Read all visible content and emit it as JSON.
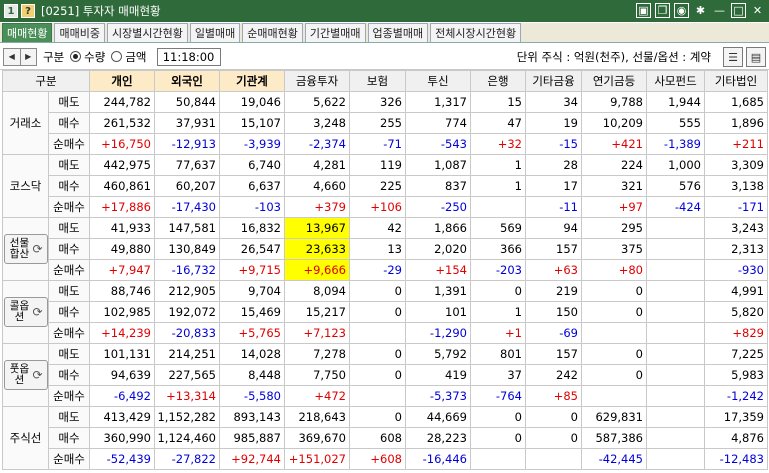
{
  "window": {
    "title": "[0251] 투자자 매매현황",
    "icon_left_1": "1",
    "icon_left_2": "?"
  },
  "tabs": [
    {
      "label": "매매현황",
      "active": true
    },
    {
      "label": "매매비중",
      "active": false
    },
    {
      "label": "시장별시간현황",
      "active": false
    },
    {
      "label": "일별매매",
      "active": false
    },
    {
      "label": "순매매현황",
      "active": false
    },
    {
      "label": "기간별매매",
      "active": false
    },
    {
      "label": "업종별매매",
      "active": false
    },
    {
      "label": "전체시장시간현황",
      "active": false
    }
  ],
  "controls": {
    "type_label": "구분",
    "qty_label": "수량",
    "amount_label": "금액",
    "selected": "수량",
    "time": "11:18:00",
    "unit_text": "단위 주식 : 억원(천주), 선물/옵션 : 계약"
  },
  "table": {
    "headers": [
      "구분",
      "개인",
      "외국인",
      "기관계",
      "금융투자",
      "보험",
      "투신",
      "은행",
      "기타금융",
      "연기금등",
      "사모펀드",
      "기타법인"
    ],
    "groups": [
      {
        "name": "거래소",
        "rows": [
          {
            "label": "매도",
            "values": [
              "244,782",
              "50,844",
              "19,046",
              "5,622",
              "326",
              "1,317",
              "15",
              "34",
              "9,788",
              "1,944",
              "1,685"
            ]
          },
          {
            "label": "매수",
            "values": [
              "261,532",
              "37,931",
              "15,107",
              "3,248",
              "255",
              "774",
              "47",
              "19",
              "10,209",
              "555",
              "1,896"
            ]
          },
          {
            "label": "순매수",
            "values": [
              "+16,750",
              "-12,913",
              "-3,939",
              "-2,374",
              "-71",
              "-543",
              "+32",
              "-15",
              "+421",
              "-1,389",
              "+211"
            ]
          }
        ]
      },
      {
        "name": "코스닥",
        "rows": [
          {
            "label": "매도",
            "values": [
              "442,975",
              "77,637",
              "6,740",
              "4,281",
              "119",
              "1,087",
              "1",
              "28",
              "224",
              "1,000",
              "3,309"
            ]
          },
          {
            "label": "매수",
            "values": [
              "460,861",
              "60,207",
              "6,637",
              "4,660",
              "225",
              "837",
              "1",
              "17",
              "321",
              "576",
              "3,138"
            ]
          },
          {
            "label": "순매수",
            "values": [
              "+17,886",
              "-17,430",
              "-103",
              "+379",
              "+106",
              "-250",
              "",
              "-11",
              "+97",
              "-424",
              "-171"
            ]
          }
        ]
      },
      {
        "name": "선물합산",
        "rows": [
          {
            "label": "매도",
            "values": [
              "41,933",
              "147,581",
              "16,832",
              "13,967",
              "42",
              "1,866",
              "569",
              "94",
              "295",
              "",
              "3,243"
            ]
          },
          {
            "label": "매수",
            "values": [
              "49,880",
              "130,849",
              "26,547",
              "23,633",
              "13",
              "2,020",
              "366",
              "157",
              "375",
              "",
              "2,313"
            ]
          },
          {
            "label": "순매수",
            "values": [
              "+7,947",
              "-16,732",
              "+9,715",
              "+9,666",
              "-29",
              "+154",
              "-203",
              "+63",
              "+80",
              "",
              "-930"
            ]
          }
        ]
      },
      {
        "name": "콜옵션",
        "rows": [
          {
            "label": "매도",
            "values": [
              "88,746",
              "212,905",
              "9,704",
              "8,094",
              "0",
              "1,391",
              "0",
              "219",
              "0",
              "",
              "4,991"
            ]
          },
          {
            "label": "매수",
            "values": [
              "102,985",
              "192,072",
              "15,469",
              "15,217",
              "0",
              "101",
              "1",
              "150",
              "0",
              "",
              "5,820"
            ]
          },
          {
            "label": "순매수",
            "values": [
              "+14,239",
              "-20,833",
              "+5,765",
              "+7,123",
              "",
              "-1,290",
              "+1",
              "-69",
              "",
              "",
              "+829"
            ]
          }
        ]
      },
      {
        "name": "풋옵션",
        "rows": [
          {
            "label": "매도",
            "values": [
              "101,131",
              "214,251",
              "14,028",
              "7,278",
              "0",
              "5,792",
              "801",
              "157",
              "0",
              "",
              "7,225"
            ]
          },
          {
            "label": "매수",
            "values": [
              "94,639",
              "227,565",
              "8,448",
              "7,750",
              "0",
              "419",
              "37",
              "242",
              "0",
              "",
              "5,983"
            ]
          },
          {
            "label": "순매수",
            "values": [
              "-6,492",
              "+13,314",
              "-5,580",
              "+472",
              "",
              "-5,373",
              "-764",
              "+85",
              "",
              "",
              "-1,242"
            ]
          }
        ]
      },
      {
        "name": "주식선",
        "rows": [
          {
            "label": "매도",
            "values": [
              "413,429",
              "1,152,282",
              "893,143",
              "218,643",
              "0",
              "44,669",
              "0",
              "0",
              "629,831",
              "",
              "17,359"
            ]
          },
          {
            "label": "매수",
            "values": [
              "360,990",
              "1,124,460",
              "985,887",
              "369,670",
              "608",
              "28,223",
              "0",
              "0",
              "587,386",
              "",
              "4,876"
            ]
          },
          {
            "label": "순매수",
            "values": [
              "-52,439",
              "-27,822",
              "+92,744",
              "+151,027",
              "+608",
              "-16,446",
              "",
              "",
              "-42,445",
              "",
              "-12,483"
            ]
          }
        ]
      }
    ]
  },
  "colors": {
    "positive": "#e00000",
    "negative": "#0000d8",
    "highlight": "#ffff00",
    "titlebar": "#2f6a3b",
    "active_tab": "#4a8f5a"
  }
}
